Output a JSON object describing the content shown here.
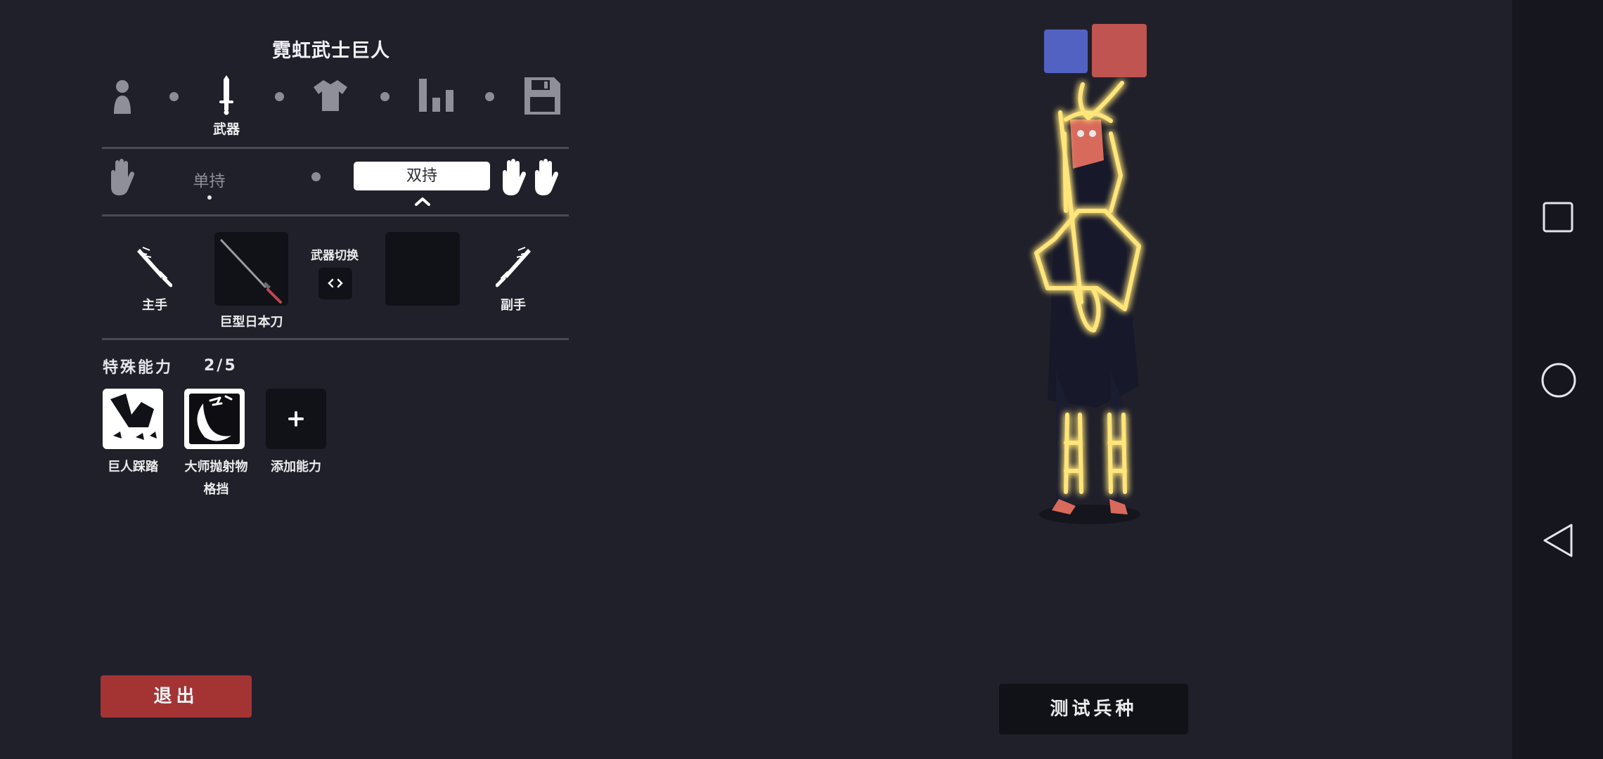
{
  "editor": {
    "title": "霓虹武士巨人",
    "tabs": [
      {
        "icon": "person-icon"
      },
      {
        "icon": "sword-icon",
        "label": "武器"
      },
      {
        "icon": "shirt-icon"
      },
      {
        "icon": "stats-icon"
      },
      {
        "icon": "save-icon"
      }
    ],
    "grip": {
      "single_label": "单持",
      "dual_label": "双持",
      "selected": "双持"
    },
    "weapons": {
      "main_hand_label": "主手",
      "off_hand_label": "副手",
      "swap_label": "武器切换",
      "main_weapon_name": "巨型日本刀"
    },
    "abilities": {
      "header": "特殊能力",
      "count": "2/5",
      "items": [
        {
          "name": "巨人踩踏",
          "icon": "giant-stomp-icon"
        },
        {
          "name": "大师抛射物格挡",
          "name_line1": "大师抛射物",
          "name_line2": "格挡",
          "icon": "projectile-block-icon"
        }
      ],
      "add_label": "添加能力"
    },
    "exit_label": "退出"
  },
  "preview": {
    "test_button": "测试兵种",
    "team_colors": {
      "blue": "#5262c2",
      "red": "#c05450"
    },
    "unit_glow_color": "#ffe066"
  },
  "colors": {
    "background": "#20202b",
    "exit_button": "#a43434"
  }
}
